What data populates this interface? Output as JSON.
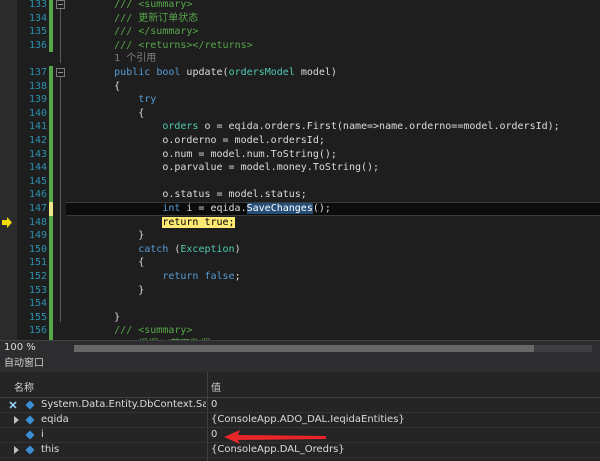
{
  "editor": {
    "lines": [
      {
        "num": "133",
        "segs": [
          {
            "c": "c",
            "t": "/// <summary>"
          }
        ],
        "indent": "        "
      },
      {
        "num": "134",
        "segs": [
          {
            "c": "c",
            "t": "/// 更新订单状态"
          }
        ],
        "indent": "        "
      },
      {
        "num": "135",
        "segs": [
          {
            "c": "c",
            "t": "/// </summary>"
          }
        ],
        "indent": "        "
      },
      {
        "num": "136",
        "segs": [
          {
            "c": "c",
            "t": "/// <returns></returns>"
          }
        ],
        "indent": "        "
      },
      {
        "num": "",
        "segs": [
          {
            "c": "g",
            "t": "1 个引用"
          }
        ],
        "indent": "        "
      },
      {
        "num": "137",
        "segs": [
          {
            "c": "k",
            "t": "public"
          },
          {
            "c": "",
            "t": " "
          },
          {
            "c": "k",
            "t": "bool"
          },
          {
            "c": "",
            "t": " update("
          },
          {
            "c": "t",
            "t": "ordersModel"
          },
          {
            "c": "",
            "t": " model)"
          }
        ],
        "indent": "        "
      },
      {
        "num": "138",
        "segs": [
          {
            "c": "",
            "t": "{"
          }
        ],
        "indent": "        "
      },
      {
        "num": "139",
        "segs": [
          {
            "c": "k",
            "t": "try"
          }
        ],
        "indent": "            "
      },
      {
        "num": "140",
        "segs": [
          {
            "c": "",
            "t": "{"
          }
        ],
        "indent": "            "
      },
      {
        "num": "141",
        "segs": [
          {
            "c": "t",
            "t": "orders"
          },
          {
            "c": "",
            "t": " o = eqida.orders.First(name=>name.orderno==model.ordersId);"
          }
        ],
        "indent": "                "
      },
      {
        "num": "142",
        "segs": [
          {
            "c": "",
            "t": "o.orderno = model.ordersId;"
          }
        ],
        "indent": "                "
      },
      {
        "num": "143",
        "segs": [
          {
            "c": "",
            "t": "o.num = model.num.ToString();"
          }
        ],
        "indent": "                "
      },
      {
        "num": "144",
        "segs": [
          {
            "c": "",
            "t": "o.parvalue = model.money.ToString();"
          }
        ],
        "indent": "                "
      },
      {
        "num": "145",
        "segs": [],
        "indent": ""
      },
      {
        "num": "146",
        "segs": [
          {
            "c": "",
            "t": "o.status = model.status;"
          }
        ],
        "indent": "                "
      },
      {
        "num": "147",
        "segs": [
          {
            "c": "k",
            "t": "int"
          },
          {
            "c": "",
            "t": " i = eqida."
          },
          {
            "c": "sel",
            "t": "SaveChanges"
          },
          {
            "c": "",
            "t": "();"
          }
        ],
        "indent": "                "
      },
      {
        "num": "148",
        "segs": [
          {
            "c": "hl",
            "t": "return true;"
          }
        ],
        "indent": "                "
      },
      {
        "num": "149",
        "segs": [
          {
            "c": "",
            "t": "}"
          }
        ],
        "indent": "            "
      },
      {
        "num": "150",
        "segs": [
          {
            "c": "k",
            "t": "catch"
          },
          {
            "c": "",
            "t": " ("
          },
          {
            "c": "t",
            "t": "Exception"
          },
          {
            "c": "",
            "t": ")"
          }
        ],
        "indent": "            "
      },
      {
        "num": "151",
        "segs": [
          {
            "c": "",
            "t": "{"
          }
        ],
        "indent": "            "
      },
      {
        "num": "152",
        "segs": [
          {
            "c": "k",
            "t": "return"
          },
          {
            "c": "",
            "t": " "
          },
          {
            "c": "k",
            "t": "false"
          },
          {
            "c": "",
            "t": ";"
          }
        ],
        "indent": "                "
      },
      {
        "num": "153",
        "segs": [
          {
            "c": "",
            "t": "}"
          }
        ],
        "indent": "            "
      },
      {
        "num": "154",
        "segs": [],
        "indent": ""
      },
      {
        "num": "155",
        "segs": [
          {
            "c": "",
            "t": "}"
          }
        ],
        "indent": "        "
      },
      {
        "num": "156",
        "segs": [
          {
            "c": "c",
            "t": "/// <summary>"
          }
        ],
        "indent": "        "
      },
      {
        "num": "157",
        "segs": [
          {
            "c": "c",
            "t": "/// 根据id获取数据"
          }
        ],
        "indent": "        "
      }
    ]
  },
  "statusbar": {
    "zoom": "100 %"
  },
  "autos": {
    "title": "自动窗口",
    "col_name": "名称",
    "col_value": "值",
    "rows": [
      {
        "name": "System.Data.Entity.DbContext.SaveC",
        "value": "0"
      },
      {
        "name": "eqida",
        "value": "{ConsoleApp.ADO_DAL.IeqidaEntities}"
      },
      {
        "name": "i",
        "value": "0"
      },
      {
        "name": "this",
        "value": "{ConsoleApp.DAL_Oredrs}"
      }
    ]
  },
  "colors": {
    "keyword": "#569cd6",
    "type": "#4ec9b0",
    "comment": "#57a64a",
    "line_number": "#2b91af",
    "selection": "#264f78",
    "current_highlight": "#ffeb74",
    "changed_bar": "#f0e68c",
    "saved_bar": "#57a64a"
  }
}
